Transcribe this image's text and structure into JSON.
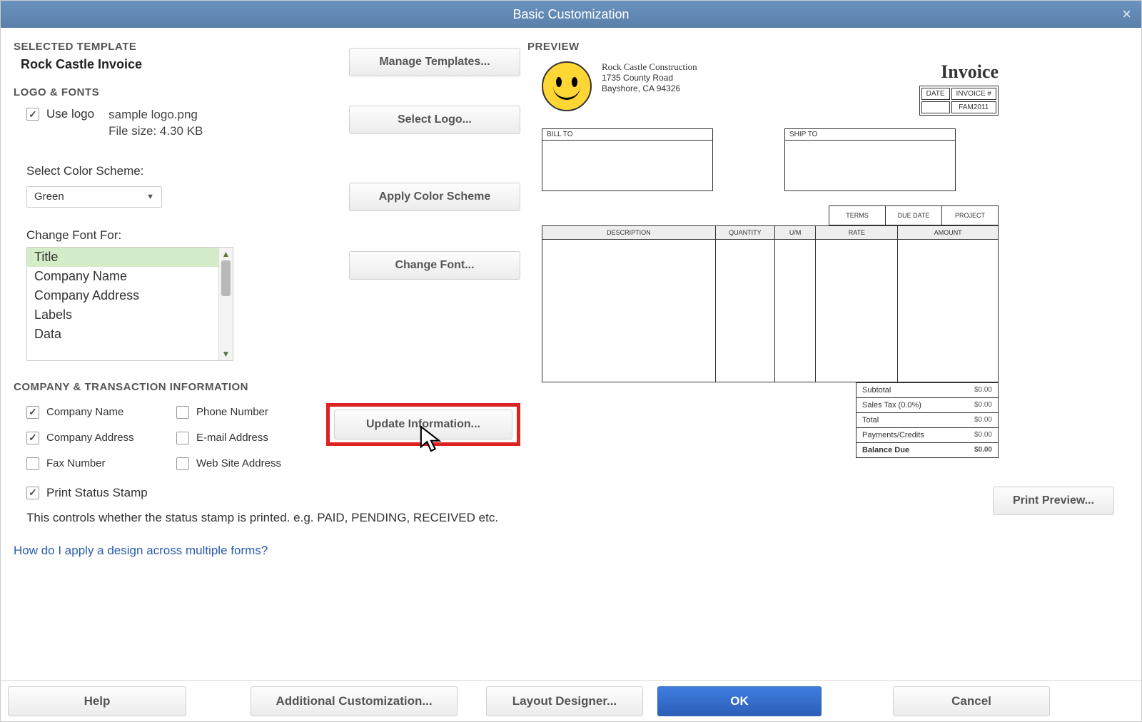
{
  "window": {
    "title": "Basic Customization"
  },
  "template": {
    "heading": "SELECTED TEMPLATE",
    "name": "Rock Castle Invoice",
    "manage_btn": "Manage Templates..."
  },
  "logo": {
    "heading": "LOGO & FONTS",
    "use_logo_label": "Use logo",
    "filename": "sample logo.png",
    "filesize": "File size: 4.30 KB",
    "select_btn": "Select Logo..."
  },
  "color": {
    "label": "Select Color Scheme:",
    "value": "Green",
    "apply_btn": "Apply Color Scheme"
  },
  "font": {
    "label": "Change Font For:",
    "items": [
      "Title",
      "Company Name",
      "Company Address",
      "Labels",
      "Data"
    ],
    "selected": "Title",
    "change_btn": "Change Font..."
  },
  "company": {
    "heading": "COMPANY & TRANSACTION INFORMATION",
    "update_btn": "Update Information...",
    "checks": {
      "company_name": {
        "label": "Company Name",
        "checked": true
      },
      "phone": {
        "label": "Phone Number",
        "checked": false
      },
      "company_address": {
        "label": "Company Address",
        "checked": true
      },
      "email": {
        "label": "E-mail Address",
        "checked": false
      },
      "fax": {
        "label": "Fax Number",
        "checked": false
      },
      "website": {
        "label": "Web Site Address",
        "checked": false
      }
    },
    "print_stamp": {
      "label": "Print Status Stamp",
      "checked": true
    },
    "stamp_help": "This controls whether the status stamp is printed. e.g. PAID, PENDING, RECEIVED etc."
  },
  "link": {
    "text": "How do I apply a design across multiple forms?"
  },
  "preview": {
    "heading": "PREVIEW",
    "company_name": "Rock Castle Construction",
    "address1": "1735 County Road",
    "address2": "Bayshore, CA 94326",
    "doc_title": "Invoice",
    "meta": {
      "date_hd": "DATE",
      "num_hd": "INVOICE #",
      "num_val": "FAM2011"
    },
    "billto": "BILL TO",
    "shipto": "SHIP TO",
    "terms_headers": [
      "TERMS",
      "DUE DATE",
      "PROJECT"
    ],
    "cols": [
      "DESCRIPTION",
      "QUANTITY",
      "U/M",
      "RATE",
      "AMOUNT"
    ],
    "totals": {
      "subtotal_l": "Subtotal",
      "subtotal_v": "$0.00",
      "tax_l": "Sales Tax (0.0%)",
      "tax_v": "$0.00",
      "total_l": "Total",
      "total_v": "$0.00",
      "pay_l": "Payments/Credits",
      "pay_v": "$0.00",
      "bal_l": "Balance Due",
      "bal_v": "$0.00"
    },
    "print_btn": "Print Preview..."
  },
  "bottom": {
    "help": "Help",
    "additional": "Additional Customization...",
    "layout": "Layout Designer...",
    "ok": "OK",
    "cancel": "Cancel"
  }
}
